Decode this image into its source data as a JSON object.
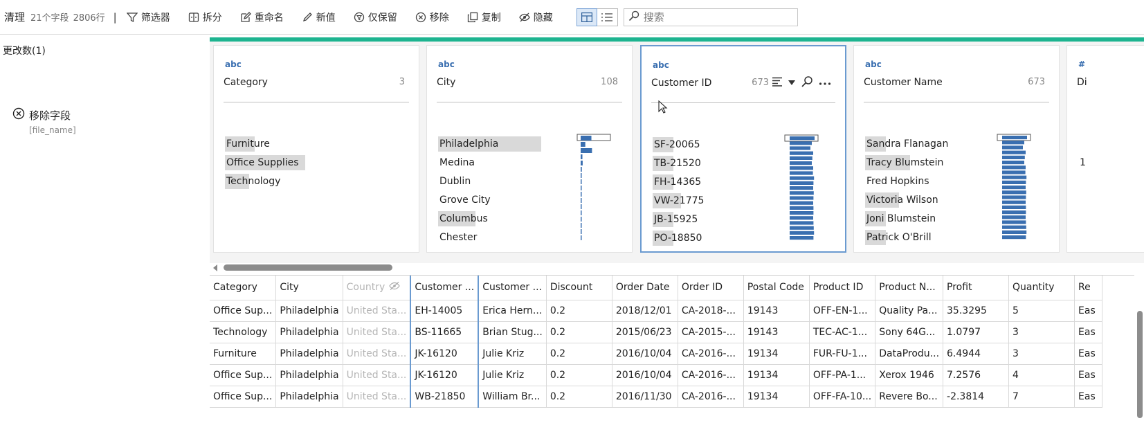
{
  "toolbar": {
    "title": "清理",
    "fields_meta": "21个字段",
    "rows_meta": "2806行",
    "separator": "|",
    "buttons": [
      "筛选器",
      "拆分",
      "重命名",
      "新值",
      "仅保留",
      "移除",
      "复制",
      "隐藏"
    ],
    "search_placeholder": "搜索"
  },
  "changes": {
    "title": "更改数(1)",
    "item_label": "移除字段",
    "item_detail": "[file_name]"
  },
  "cards": [
    {
      "type": "abc",
      "name": "Category",
      "count": "3",
      "values": [
        "Furniture",
        "Office Supplies",
        "Technology"
      ],
      "highlight": [
        0.16,
        0.43,
        0.13
      ]
    },
    {
      "type": "abc",
      "name": "City",
      "count": "108",
      "values": [
        "Philadelphia",
        "Medina",
        "Dublin",
        "Grove City",
        "Columbus",
        "Chester"
      ],
      "highlight": [
        0.55,
        0.0,
        0.0,
        0.0,
        0.2,
        0.0
      ],
      "bars": [
        0.37,
        0.16,
        0.39,
        0.06,
        0.07,
        0.04,
        0.03,
        0.03,
        0.03,
        0.03,
        0.02,
        0.02,
        0.02,
        0.02,
        0.02,
        0.02,
        0.02
      ]
    },
    {
      "type": "abc",
      "name": "Customer ID",
      "count": "673",
      "values": [
        "SF-20065",
        "TB-21520",
        "FH-14365",
        "VW-21775",
        "JB-15925",
        "PO-18850"
      ],
      "highlight": [
        0.11,
        0.11,
        0.11,
        0.15,
        0.11,
        0.11
      ],
      "bars": [
        0.9,
        0.8,
        0.75,
        0.85,
        0.82,
        0.8,
        0.85,
        0.84,
        0.88,
        0.86,
        0.85,
        0.87,
        0.86,
        0.85,
        0.86,
        0.86,
        0.85,
        0.86,
        0.87,
        0.88,
        0.86
      ]
    },
    {
      "type": "abc",
      "name": "Customer Name",
      "count": "673",
      "values": [
        "Sandra Flanagan",
        "Tracy Blumstein",
        "Fred Hopkins",
        "Victoria Wilson",
        "Joni Blumstein",
        "Patrick O'Brill"
      ],
      "highlight": [
        0.11,
        0.24,
        0.0,
        0.18,
        0.11,
        0.11
      ],
      "bars": [
        0.9,
        0.8,
        0.75,
        0.85,
        0.82,
        0.8,
        0.85,
        0.84,
        0.88,
        0.86,
        0.85,
        0.87,
        0.86,
        0.85,
        0.86,
        0.86,
        0.85,
        0.86,
        0.87,
        0.88,
        0.86
      ]
    },
    {
      "type": "#",
      "name": "Di",
      "count": "",
      "values": [
        "",
        "1"
      ],
      "highlight": [
        0,
        0
      ]
    }
  ],
  "colors": {
    "accent_bar": "#1db490",
    "data_bar": "#3a6fb0",
    "highlight": "#d9d9d9",
    "selection": "#6a9ad0"
  },
  "table": {
    "columns": [
      "Category",
      "City",
      "Country",
      "Customer ...",
      "Customer ...",
      "Discount",
      "Order Date",
      "Order ID",
      "Postal Code",
      "Product ID",
      "Product N...",
      "Profit",
      "Quantity",
      "Re"
    ],
    "rows": [
      [
        "Office Sup...",
        "Philadelphia",
        "United Sta...",
        "EH-14005",
        "Erica Hern...",
        "0.2",
        "2018/12/01",
        "CA-2018-...",
        "19143",
        "OFF-EN-1...",
        "Quality Pa...",
        "35.3295",
        "5",
        "Eas"
      ],
      [
        "Technology",
        "Philadelphia",
        "United Sta...",
        "BS-11665",
        "Brian Stug...",
        "0.2",
        "2015/06/23",
        "CA-2015-...",
        "19143",
        "TEC-AC-1...",
        "Sony 64G...",
        "1.0797",
        "3",
        "Eas"
      ],
      [
        "Furniture",
        "Philadelphia",
        "United Sta...",
        "JK-16120",
        "Julie Kriz",
        "0.2",
        "2016/10/04",
        "CA-2016-...",
        "19134",
        "FUR-FU-1...",
        "DataProdu...",
        "6.4944",
        "3",
        "Eas"
      ],
      [
        "Office Sup...",
        "Philadelphia",
        "United Sta...",
        "JK-16120",
        "Julie Kriz",
        "0.2",
        "2016/10/04",
        "CA-2016-...",
        "19134",
        "OFF-PA-1...",
        "Xerox 1946",
        "7.2576",
        "4",
        "Eas"
      ],
      [
        "Office Sup...",
        "Philadelphia",
        "United Sta...",
        "WB-21850",
        "William Br...",
        "0.2",
        "2016/11/30",
        "CA-2016-...",
        "19134",
        "OFF-FA-10...",
        "Revere Bo...",
        "-2.3814",
        "7",
        "Eas"
      ]
    ]
  }
}
